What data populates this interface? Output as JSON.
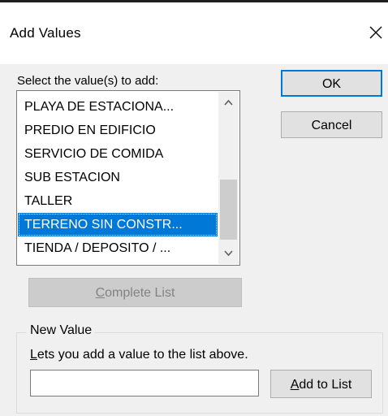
{
  "window": {
    "title": "Add Values",
    "close_icon": "close-icon"
  },
  "select_label": "Select the value(s) to add:",
  "list": {
    "items": [
      "PLAYA DE ESTACIONA...",
      "PREDIO EN EDIFICIO",
      "SERVICIO DE COMIDA",
      "SUB ESTACION",
      "TALLER",
      "TERRENO SIN CONSTR...",
      "TIENDA / DEPOSITO / ..."
    ],
    "selected_index": 5,
    "selected_color": "#0078d7",
    "scroll_up_icon": "chevron-up-icon",
    "scroll_down_icon": "chevron-down-icon"
  },
  "buttons": {
    "ok": "OK",
    "cancel": "Cancel",
    "complete_list": {
      "accel": "C",
      "rest": "omplete List"
    },
    "add_to_list": {
      "accel": "A",
      "rest": "dd to List"
    }
  },
  "new_value": {
    "group_label": "New Value",
    "description": {
      "accel": "L",
      "rest": "ets you add a value to the list above."
    },
    "input_value": ""
  }
}
